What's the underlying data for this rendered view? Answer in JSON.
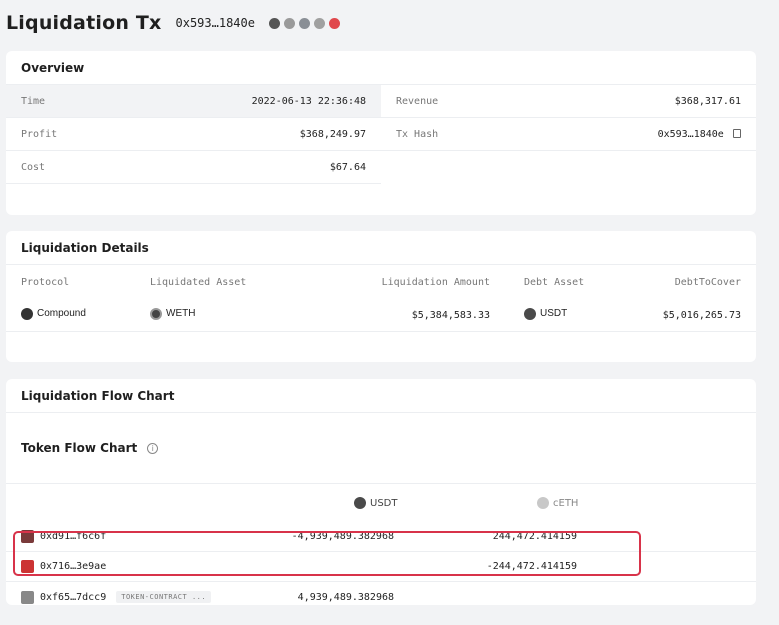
{
  "header": {
    "title": "Liquidation Tx",
    "hash": "0x593…1840e"
  },
  "overview": {
    "title": "Overview",
    "left": [
      {
        "label": "Time",
        "value": "2022-06-13 22:36:48"
      },
      {
        "label": "Profit",
        "value": "$368,249.97"
      },
      {
        "label": "Cost",
        "value": "$67.64"
      }
    ],
    "right": [
      {
        "label": "Revenue",
        "value": "$368,317.61"
      },
      {
        "label": "Tx Hash",
        "value": "0x593…1840e"
      }
    ]
  },
  "liquidation": {
    "title": "Liquidation Details",
    "headers": [
      "Protocol",
      "Liquidated Asset",
      "Liquidation Amount",
      "Debt Asset",
      "DebtToCover"
    ],
    "row": {
      "protocol": "Compound",
      "liquidated_asset": "WETH",
      "amount": "$5,384,583.33",
      "debt_asset": "USDT",
      "debt_to_cover": "$5,016,265.73"
    }
  },
  "flow": {
    "title": "Liquidation Flow Chart",
    "subtitle": "Token Flow Chart",
    "col_usdt": "USDT",
    "col_ceth": "cETH",
    "rows": [
      {
        "address": "0xd91…f6c6f",
        "usdt": "-4,939,489.382968",
        "ceth": "244,472.414159"
      },
      {
        "address": "0x716…3e9ae",
        "usdt": "",
        "ceth": "-244,472.414159"
      },
      {
        "address": "0xf65…7dcc9",
        "tag": "TOKEN-CONTRACT ...",
        "usdt": "4,939,489.382968",
        "ceth": ""
      }
    ]
  },
  "colors": {
    "highlight": "#d8334a",
    "usdt": "#26a17b"
  }
}
